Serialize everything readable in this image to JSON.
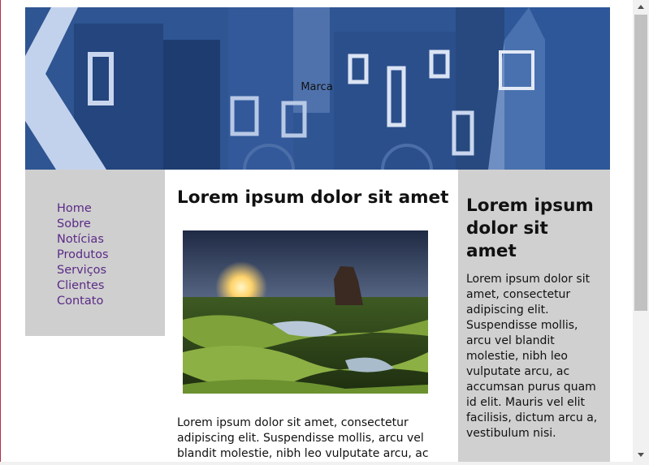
{
  "header": {
    "brand": "Marca"
  },
  "nav": {
    "items": [
      "Home",
      "Sobre",
      "Notícias",
      "Produtos",
      "Serviços",
      "Clientes",
      "Contato"
    ]
  },
  "main": {
    "heading": "Lorem ipsum dolor sit amet",
    "text": "Lorem ipsum dolor sit amet, consectetur adipiscing elit. Suspendisse mollis, arcu vel blandit molestie, nibh leo vulputate arcu, ac"
  },
  "aside": {
    "heading": "Lorem ipsum dolor sit amet",
    "text": "Lorem ipsum dolor sit amet, consectetur adipiscing elit. Suspendisse mollis, arcu vel blandit molestie, nibh leo vulputate arcu, ac accumsan purus quam id elit. Mauris vel elit facilisis, dictum arcu a, vestibulum nisi."
  },
  "colors": {
    "header_blue": "#2a4f8c",
    "sidebar_gray": "#cfcfcf",
    "nav_link": "#5b2a86"
  },
  "icons": {
    "scroll_up": "chevron-up-icon",
    "scroll_down": "chevron-down-icon"
  }
}
